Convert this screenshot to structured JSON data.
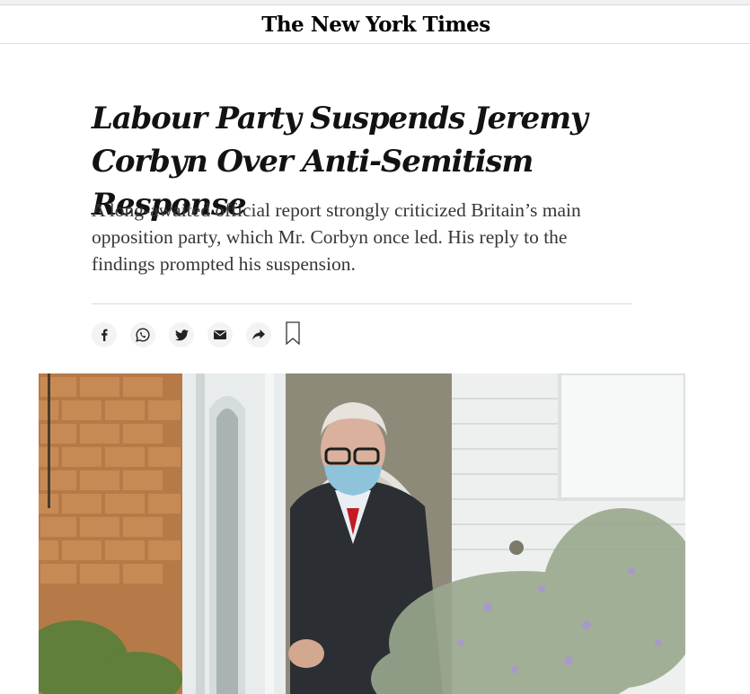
{
  "masthead": {
    "logo_text": "The New York Times"
  },
  "article": {
    "headline": "Labour Party Suspends Jeremy Corbyn Over Anti-Semitism Response",
    "summary": "A long-awaited official report strongly criticized Britain’s main opposition party, which Mr. Corbyn once led. His reply to the findings prompted his suspension."
  },
  "share_bar": {
    "buttons": [
      {
        "icon": "facebook-icon"
      },
      {
        "icon": "whatsapp-icon"
      },
      {
        "icon": "twitter-icon"
      },
      {
        "icon": "email-icon"
      },
      {
        "icon": "share-arrow-icon"
      }
    ],
    "bookmark_icon": "bookmark-icon"
  },
  "colors": {
    "text": "#121212",
    "summary_text": "#363636",
    "divider": "#dcdcdc",
    "share_bg": "#f3f3f3"
  }
}
